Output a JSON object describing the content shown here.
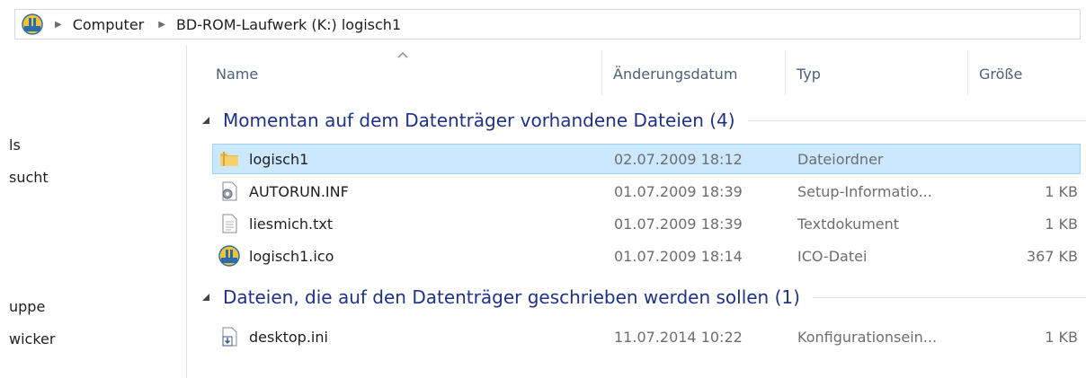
{
  "address": {
    "crumbs": [
      "Computer",
      "BD-ROM-Laufwerk (K:) logisch1"
    ]
  },
  "nav": {
    "items": [
      "ls",
      "sucht",
      "uppe",
      "wicker"
    ]
  },
  "columns": {
    "name": "Name",
    "date": "Änderungsdatum",
    "type": "Typ",
    "size": "Größe"
  },
  "groups": [
    {
      "title": "Momentan auf dem Datenträger vorhandene Dateien (4)",
      "files": [
        {
          "name": "logisch1",
          "date": "02.07.2009 18:12",
          "type": "Dateiordner",
          "size": "",
          "icon": "folder-icon",
          "selected": true
        },
        {
          "name": "AUTORUN.INF",
          "date": "01.07.2009 18:39",
          "type": "Setup-Informatio...",
          "size": "1 KB",
          "icon": "setup-file-icon",
          "selected": false
        },
        {
          "name": "liesmich.txt",
          "date": "01.07.2009 18:39",
          "type": "Textdokument",
          "size": "1 KB",
          "icon": "text-file-icon",
          "selected": false
        },
        {
          "name": "logisch1.ico",
          "date": "01.07.2009 18:14",
          "type": "ICO-Datei",
          "size": "367 KB",
          "icon": "ico-file-icon",
          "selected": false
        }
      ]
    },
    {
      "title": "Dateien, die auf den Datenträger geschrieben werden sollen (1)",
      "files": [
        {
          "name": "desktop.ini",
          "date": "11.07.2014 10:22",
          "type": "Konfigurationsein...",
          "size": "1 KB",
          "icon": "pending-burn-file-icon",
          "selected": false
        }
      ]
    }
  ],
  "colors": {
    "group_title": "#1e3287",
    "selection_fill": "#cce8ff",
    "selection_border": "#99d1ff"
  }
}
